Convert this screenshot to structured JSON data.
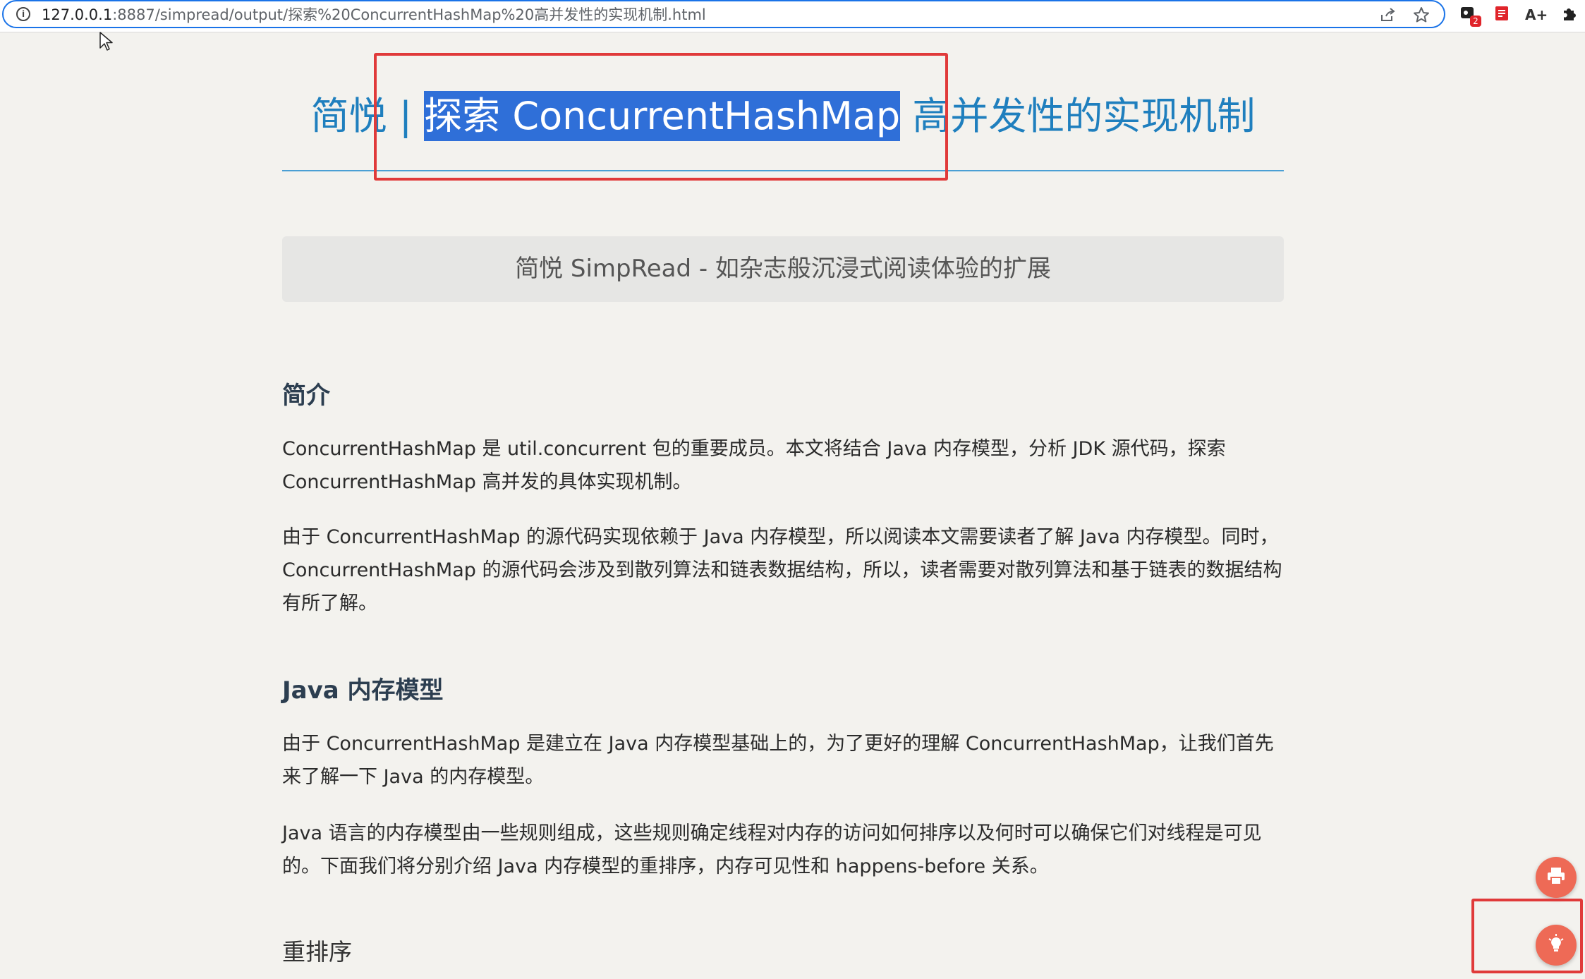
{
  "browser": {
    "url_host": "127.0.0.1",
    "url_rest": ":8887/simpread/output/探索%20ConcurrentHashMap%20高并发性的实现机制.html",
    "info_icon": "i",
    "extensions": {
      "badge_count": "2",
      "font_label": "A+"
    }
  },
  "article": {
    "title_prefix": "简悦 | ",
    "title_selected": "探索 ConcurrentHashMap",
    "title_suffix": " 高并发性的实现机制",
    "tagline": "简悦 SimpRead - 如杂志般沉浸式阅读体验的扩展",
    "section1_heading": "简介",
    "section1_p1": "ConcurrentHashMap 是 util.concurrent 包的重要成员。本文将结合 Java 内存模型，分析 JDK 源代码，探索 ConcurrentHashMap 高并发的具体实现机制。",
    "section1_p2": "由于 ConcurrentHashMap 的源代码实现依赖于 Java 内存模型，所以阅读本文需要读者了解 Java 内存模型。同时，ConcurrentHashMap 的源代码会涉及到散列算法和链表数据结构，所以，读者需要对散列算法和基于链表的数据结构有所了解。",
    "section2_heading": "Java 内存模型",
    "section2_p1": "由于 ConcurrentHashMap 是建立在 Java 内存模型基础上的，为了更好的理解 ConcurrentHashMap，让我们首先来了解一下 Java 的内存模型。",
    "section2_p2": "Java 语言的内存模型由一些规则组成，这些规则确定线程对内存的访问如何排序以及何时可以确保它们对线程是可见的。下面我们将分别介绍 Java 内存模型的重排序，内存可见性和 happens-before 关系。",
    "section3_heading": "重排序"
  },
  "colors": {
    "accent": "#1f7fbe",
    "selection": "#2f6fd8",
    "highlight_box": "#e03a3a",
    "fab": "#ee6a56"
  }
}
